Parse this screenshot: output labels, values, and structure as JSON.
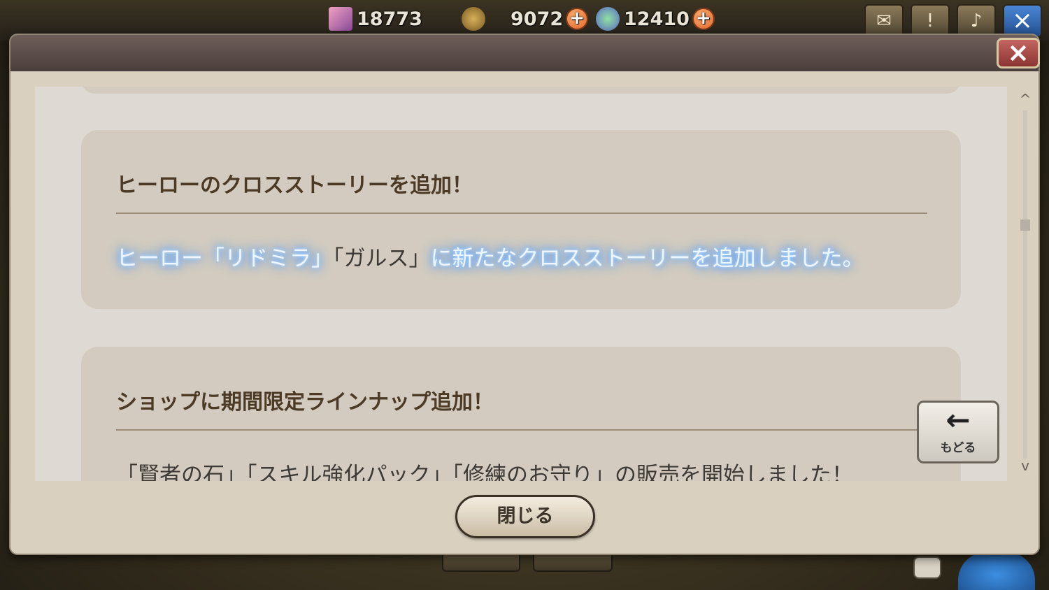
{
  "hud": {
    "crystals": "18773",
    "gold": "9072",
    "gems": "12410"
  },
  "dialog": {
    "close_icon": "×",
    "items": [
      {
        "title": "ヒーローのクロスストーリーを追加！",
        "body_glow_1": "ヒーロー「リドミラ」",
        "body_plain": "「ガルス」",
        "body_glow_2": "に新たなクロスストーリーを追加しました。"
      },
      {
        "title": "ショップに期間限定ラインナップ追加！",
        "body": "「賢者の石」「スキル強化パック」「修練のお守り」の販売を開始しました！"
      }
    ],
    "back_label": "もどる",
    "back_arrow": "←",
    "close_button": "閉じる"
  },
  "icons": {
    "scroll_up": "^",
    "scroll_down": "v"
  }
}
